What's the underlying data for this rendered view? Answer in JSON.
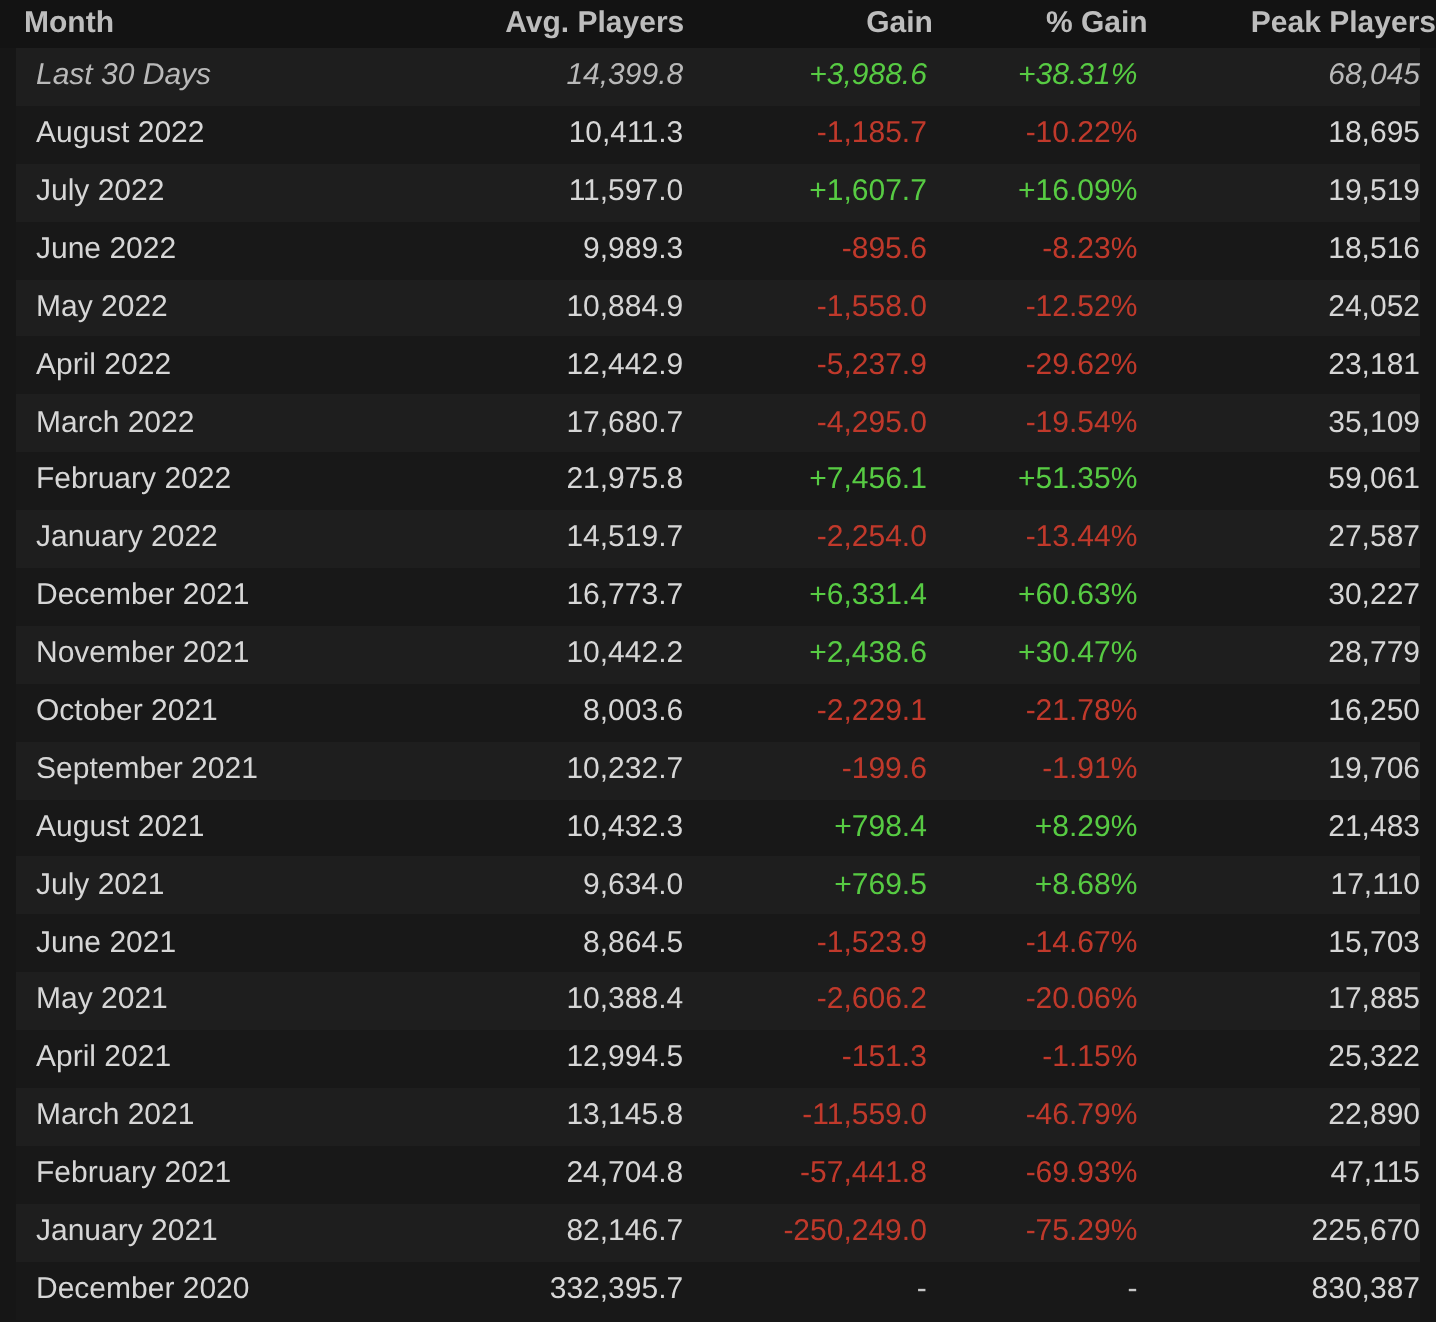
{
  "table": {
    "columns": [
      "Month",
      "Avg. Players",
      "Gain",
      "% Gain",
      "Peak Players"
    ],
    "rows": [
      {
        "kind": "recent",
        "color": "#57cb43",
        "month": "Last 30 Days",
        "avg": "14,399.8",
        "gain": "+3,988.6",
        "pct": "+38.31%",
        "peak": "68,045"
      },
      {
        "kind": "month",
        "color": "#c0392b",
        "month": "August 2022",
        "avg": "10,411.3",
        "gain": "-1,185.7",
        "pct": "-10.22%",
        "peak": "18,695"
      },
      {
        "kind": "month",
        "color": "#57cb43",
        "month": "July 2022",
        "avg": "11,597.0",
        "gain": "+1,607.7",
        "pct": "+16.09%",
        "peak": "19,519"
      },
      {
        "kind": "month",
        "color": "#c0392b",
        "month": "June 2022",
        "avg": "9,989.3",
        "gain": "-895.6",
        "pct": "-8.23%",
        "peak": "18,516"
      },
      {
        "kind": "month",
        "color": "#c0392b",
        "month": "May 2022",
        "avg": "10,884.9",
        "gain": "-1,558.0",
        "pct": "-12.52%",
        "peak": "24,052"
      },
      {
        "kind": "month",
        "color": "#c0392b",
        "month": "April 2022",
        "avg": "12,442.9",
        "gain": "-5,237.9",
        "pct": "-29.62%",
        "peak": "23,181"
      },
      {
        "kind": "month",
        "color": "#c0392b",
        "month": "March 2022",
        "avg": "17,680.7",
        "gain": "-4,295.0",
        "pct": "-19.54%",
        "peak": "35,109"
      },
      {
        "kind": "month",
        "color": "#57cb43",
        "month": "February 2022",
        "avg": "21,975.8",
        "gain": "+7,456.1",
        "pct": "+51.35%",
        "peak": "59,061"
      },
      {
        "kind": "month",
        "color": "#c0392b",
        "month": "January 2022",
        "avg": "14,519.7",
        "gain": "-2,254.0",
        "pct": "-13.44%",
        "peak": "27,587"
      },
      {
        "kind": "month",
        "color": "#57cb43",
        "month": "December 2021",
        "avg": "16,773.7",
        "gain": "+6,331.4",
        "pct": "+60.63%",
        "peak": "30,227"
      },
      {
        "kind": "month",
        "color": "#57cb43",
        "month": "November 2021",
        "avg": "10,442.2",
        "gain": "+2,438.6",
        "pct": "+30.47%",
        "peak": "28,779"
      },
      {
        "kind": "month",
        "color": "#c0392b",
        "month": "October 2021",
        "avg": "8,003.6",
        "gain": "-2,229.1",
        "pct": "-21.78%",
        "peak": "16,250"
      },
      {
        "kind": "month",
        "color": "#c0392b",
        "month": "September 2021",
        "avg": "10,232.7",
        "gain": "-199.6",
        "pct": "-1.91%",
        "peak": "19,706"
      },
      {
        "kind": "month",
        "color": "#57cb43",
        "month": "August 2021",
        "avg": "10,432.3",
        "gain": "+798.4",
        "pct": "+8.29%",
        "peak": "21,483"
      },
      {
        "kind": "month",
        "color": "#57cb43",
        "month": "July 2021",
        "avg": "9,634.0",
        "gain": "+769.5",
        "pct": "+8.68%",
        "peak": "17,110"
      },
      {
        "kind": "month",
        "color": "#c0392b",
        "month": "June 2021",
        "avg": "8,864.5",
        "gain": "-1,523.9",
        "pct": "-14.67%",
        "peak": "15,703"
      },
      {
        "kind": "month",
        "color": "#c0392b",
        "month": "May 2021",
        "avg": "10,388.4",
        "gain": "-2,606.2",
        "pct": "-20.06%",
        "peak": "17,885"
      },
      {
        "kind": "month",
        "color": "#c0392b",
        "month": "April 2021",
        "avg": "12,994.5",
        "gain": "-151.3",
        "pct": "-1.15%",
        "peak": "25,322"
      },
      {
        "kind": "month",
        "color": "#c0392b",
        "month": "March 2021",
        "avg": "13,145.8",
        "gain": "-11,559.0",
        "pct": "-46.79%",
        "peak": "22,890"
      },
      {
        "kind": "month",
        "color": "#c0392b",
        "month": "February 2021",
        "avg": "24,704.8",
        "gain": "-57,441.8",
        "pct": "-69.93%",
        "peak": "47,115"
      },
      {
        "kind": "month",
        "color": "#c0392b",
        "month": "January 2021",
        "avg": "82,146.7",
        "gain": "-250,249.0",
        "pct": "-75.29%",
        "peak": "225,670"
      },
      {
        "kind": "month",
        "color": "#c6c6c6",
        "month": "December 2020",
        "avg": "332,395.7",
        "gain": "-",
        "pct": "-",
        "peak": "830,387"
      }
    ]
  }
}
